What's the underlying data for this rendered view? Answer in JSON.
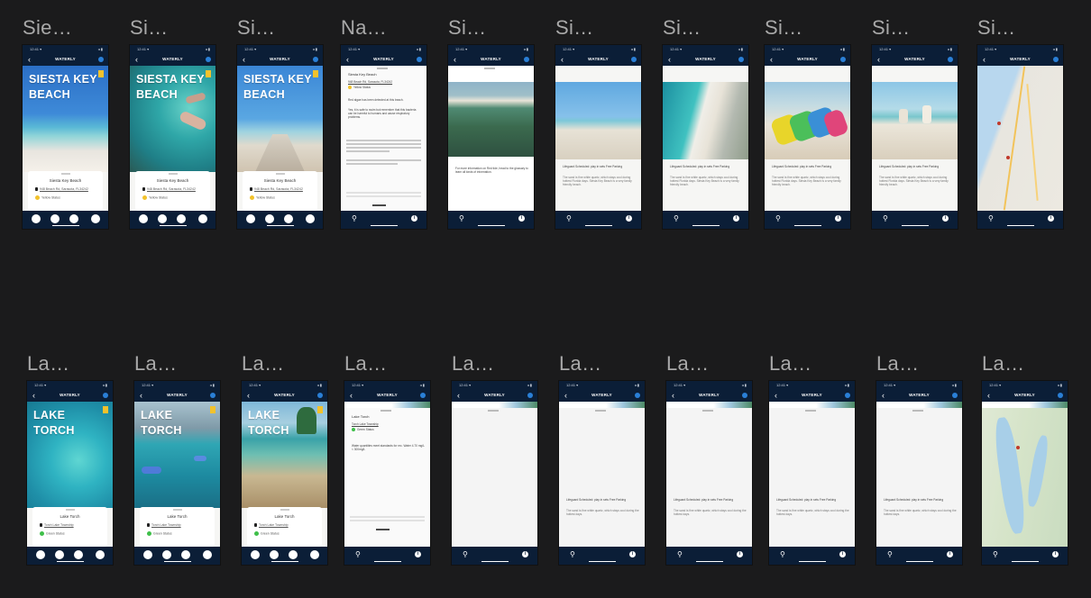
{
  "row1_labels": [
    "Sie…",
    "Si…",
    "Si…",
    "Na…",
    "Si…",
    "Si…",
    "Si…",
    "Si…",
    "Si…",
    "Si…"
  ],
  "row2_labels": [
    "La…",
    "La…",
    "La…",
    "La…",
    "La…",
    "La…",
    "La…",
    "La…",
    "La…",
    "La…"
  ],
  "phone": {
    "status_time": "12:41 ▾",
    "status_right": "◂ ▮",
    "back_glyph": "‹",
    "app_title": "WATERLY",
    "pin_glyph": "⚲",
    "info_glyph": "i"
  },
  "siesta": {
    "hero_title_line1": "SIESTA KEY",
    "hero_title_line2": "BEACH",
    "card_name": "Siesta Key Beach",
    "card_address": "948 Beach Rd, Sarasota, FL34242",
    "card_status": "Yellow Status",
    "detail_intro": "Red algae has been detected at this beach.",
    "detail_body": "Yes, it is safe to swim but remember that this bacteria can be harmful to humans and cause respiratory problems.",
    "pager_label": "For more information on Red tide, head to the glossary to learn all kinds of information.",
    "lifeguard_text": "Lifeguard Scheduled: play in sets  Free Parking",
    "desc_text": "The sand is fine white quartz, which stays cool during hottest Florida days. Siesta Key Beach is a very family friendly beach."
  },
  "lake": {
    "hero_title_line1": "LAKE",
    "hero_title_line2": "TORCH",
    "card_name": "Lake Torch",
    "card_address": "Torch Lake Township",
    "card_status": "Green Status",
    "detail_body": "Water quantities meet standards for rec. Water 4.70 mg/L < 300mg/L",
    "lifeguard_text": "Lifeguard Scheduled: play in sets  Free Parking",
    "desc_text": "The sand is fine white quartz, which stays cool during the hottest days."
  },
  "colors": {
    "background": "#1b1b1c",
    "navbar": "#0b1e37",
    "yellow_status": "#f2c22c",
    "green_status": "#3fbf4a",
    "label": "#a9a9a9"
  }
}
